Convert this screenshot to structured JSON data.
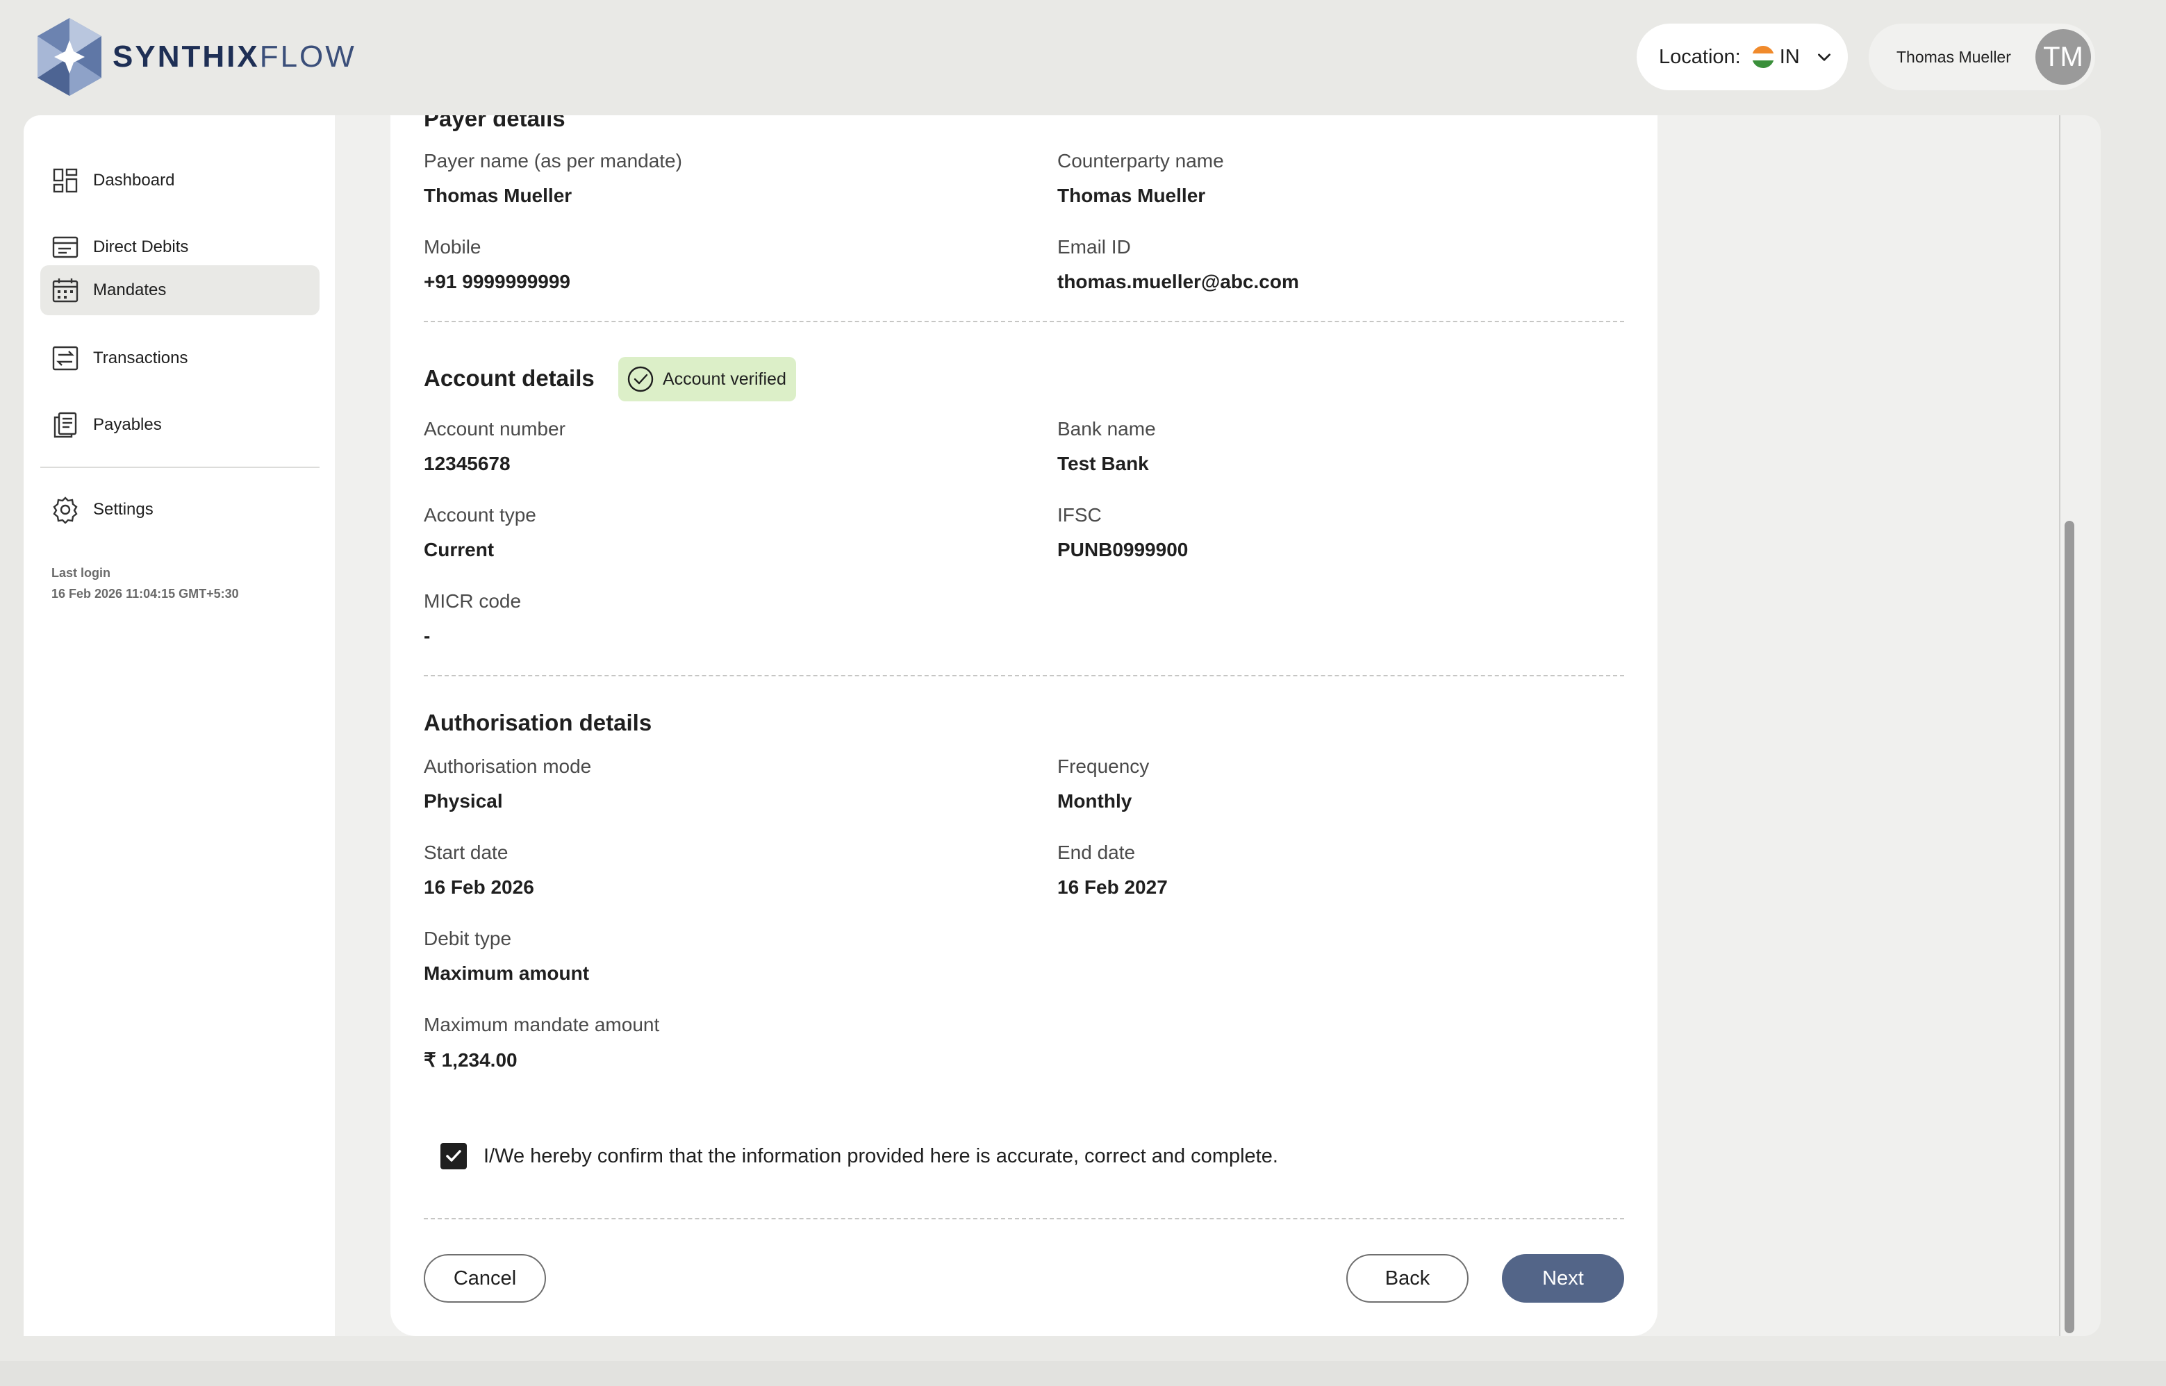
{
  "header": {
    "brand_bold": "SYNTHIX",
    "brand_light": "FLOW",
    "location_label": "Location:",
    "location_value": "IN",
    "user_name": "Thomas Mueller",
    "avatar_initials": "TM"
  },
  "sidebar": {
    "items": [
      {
        "label": "Dashboard",
        "icon": "dashboard-icon"
      },
      {
        "label": "Direct Debits",
        "icon": "direct-debits-icon"
      },
      {
        "label": "Mandates",
        "icon": "calendar-icon",
        "active": true
      },
      {
        "label": "Transactions",
        "icon": "transactions-icon"
      },
      {
        "label": "Payables",
        "icon": "payables-icon"
      },
      {
        "label": "Settings",
        "icon": "gear-icon"
      }
    ],
    "last_login_label": "Last login",
    "last_login_value": "16 Feb 2026 11:04:15 GMT+5:30"
  },
  "payer": {
    "title": "Payer details",
    "payer_name_label": "Payer name (as per mandate)",
    "payer_name": "Thomas Mueller",
    "counterparty_label": "Counterparty name",
    "counterparty": "Thomas Mueller",
    "mobile_label": "Mobile",
    "mobile": "+91 9999999999",
    "email_label": "Email ID",
    "email": "thomas.mueller@abc.com"
  },
  "account": {
    "title": "Account details",
    "verified_badge": "Account verified",
    "number_label": "Account number",
    "number": "12345678",
    "bank_label": "Bank name",
    "bank": "Test Bank",
    "type_label": "Account type",
    "type": "Current",
    "ifsc_label": "IFSC",
    "ifsc": "PUNB0999900",
    "micr_label": "MICR code",
    "micr": "-"
  },
  "authorisation": {
    "title": "Authorisation details",
    "mode_label": "Authorisation mode",
    "mode": "Physical",
    "frequency_label": "Frequency",
    "frequency": "Monthly",
    "start_label": "Start date",
    "start": "16 Feb 2026",
    "end_label": "End date",
    "end": "16 Feb 2027",
    "debit_type_label": "Debit type",
    "debit_type": "Maximum amount",
    "max_amount_label": "Maximum mandate amount",
    "max_amount": "₹ 1,234.00"
  },
  "confirm": {
    "text": "I/We hereby confirm that the information provided here is accurate, correct and complete.",
    "checked": true
  },
  "actions": {
    "cancel": "Cancel",
    "back": "Back",
    "next": "Next"
  },
  "colors": {
    "primary": "#536588",
    "verified_bg": "#dcefc8",
    "page_bg": "#e9e9e6"
  }
}
